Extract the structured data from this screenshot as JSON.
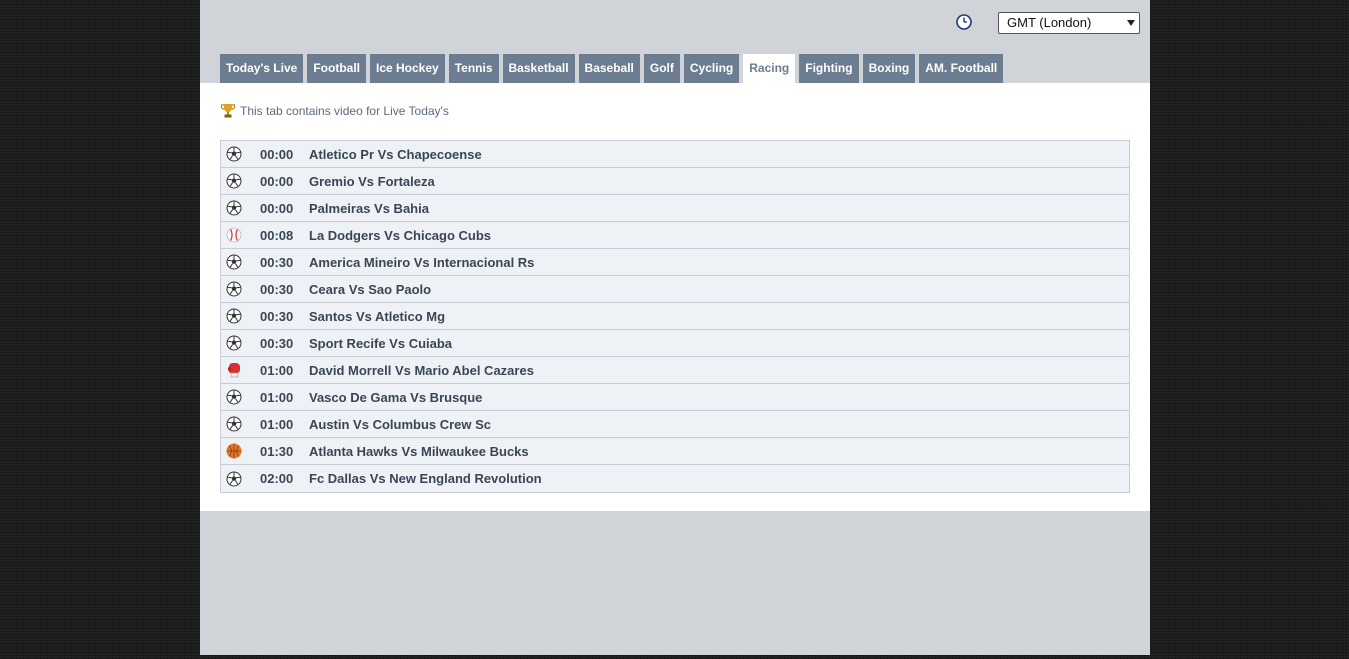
{
  "timezone": {
    "selected": "GMT (London)"
  },
  "tabs": [
    {
      "label": "Today's Live",
      "active": false
    },
    {
      "label": "Football",
      "active": false
    },
    {
      "label": "Ice Hockey",
      "active": false
    },
    {
      "label": "Tennis",
      "active": false
    },
    {
      "label": "Basketball",
      "active": false
    },
    {
      "label": "Baseball",
      "active": false
    },
    {
      "label": "Golf",
      "active": false
    },
    {
      "label": "Cycling",
      "active": false
    },
    {
      "label": "Racing",
      "active": true
    },
    {
      "label": "Fighting",
      "active": false
    },
    {
      "label": "Boxing",
      "active": false
    },
    {
      "label": "AM. Football",
      "active": false
    }
  ],
  "notice": {
    "icon": "trophy-icon",
    "text": "This tab contains video for Live Today's"
  },
  "events": [
    {
      "sport": "football",
      "time": "00:00",
      "match": "Atletico Pr Vs Chapecoense"
    },
    {
      "sport": "football",
      "time": "00:00",
      "match": "Gremio Vs Fortaleza"
    },
    {
      "sport": "football",
      "time": "00:00",
      "match": "Palmeiras Vs Bahia"
    },
    {
      "sport": "baseball",
      "time": "00:08",
      "match": "La Dodgers Vs Chicago Cubs"
    },
    {
      "sport": "football",
      "time": "00:30",
      "match": "America Mineiro Vs Internacional Rs"
    },
    {
      "sport": "football",
      "time": "00:30",
      "match": "Ceara Vs Sao Paolo"
    },
    {
      "sport": "football",
      "time": "00:30",
      "match": "Santos Vs Atletico Mg"
    },
    {
      "sport": "football",
      "time": "00:30",
      "match": "Sport Recife Vs Cuiaba"
    },
    {
      "sport": "boxing",
      "time": "01:00",
      "match": "David Morrell Vs Mario Abel Cazares"
    },
    {
      "sport": "football",
      "time": "01:00",
      "match": "Vasco De Gama Vs Brusque"
    },
    {
      "sport": "football",
      "time": "01:00",
      "match": "Austin Vs Columbus Crew Sc"
    },
    {
      "sport": "basketball",
      "time": "01:30",
      "match": "Atlanta Hawks Vs Milwaukee Bucks"
    },
    {
      "sport": "football",
      "time": "02:00",
      "match": "Fc Dallas Vs New England Revolution"
    }
  ],
  "colors": {
    "tab": "#6d7d91",
    "panel": "#d0d3d7",
    "row": "#eef2f6",
    "text": "#3a4656"
  }
}
